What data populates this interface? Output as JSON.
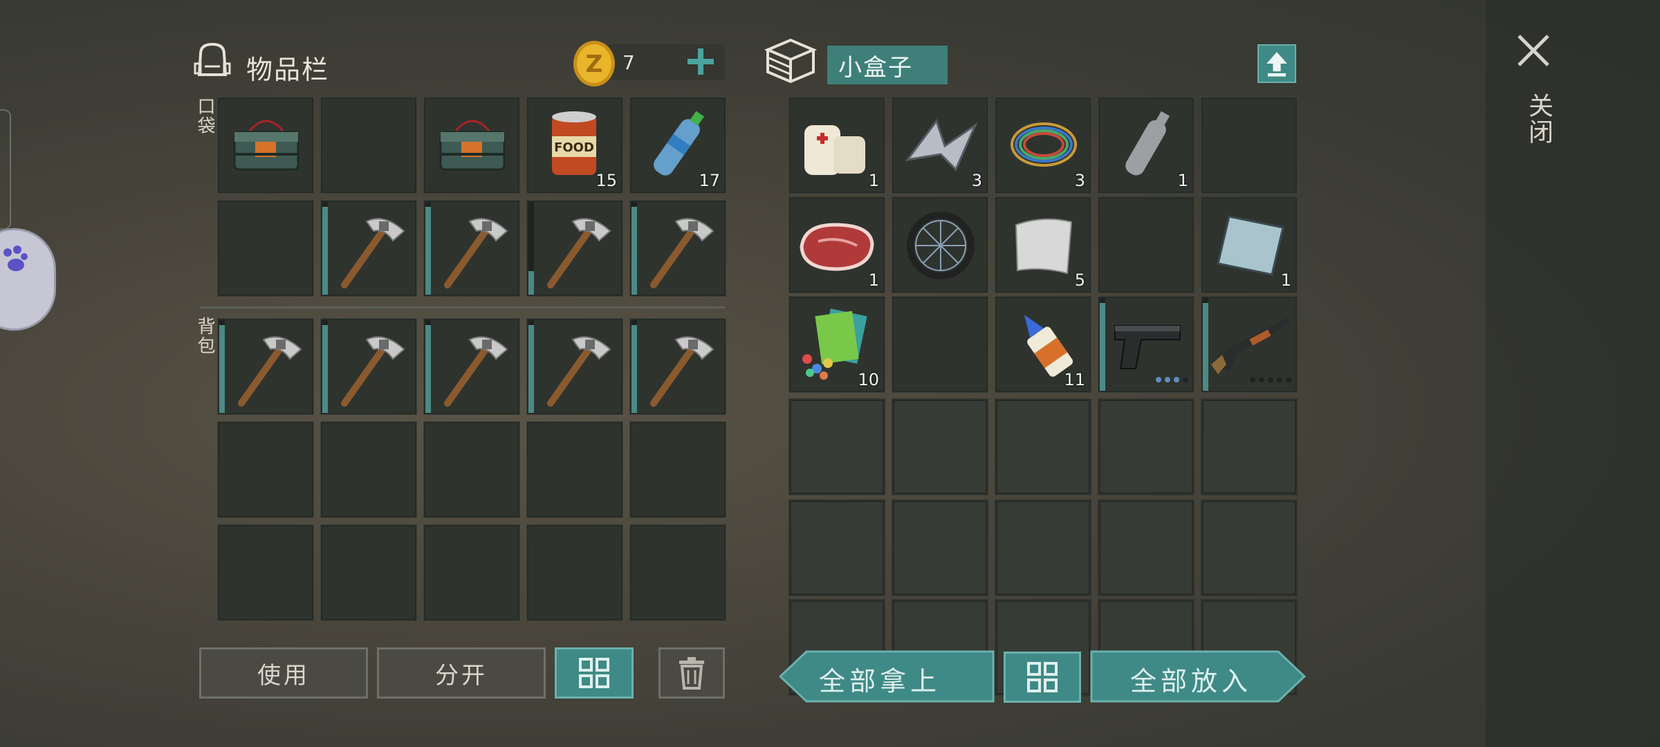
{
  "inventory": {
    "title": "物品栏",
    "coins": "7",
    "pocket_label": "口袋",
    "backpack_label": "背包",
    "pocket_slots": [
      {
        "item": "dynamite-bundle"
      },
      {
        "item": ""
      },
      {
        "item": "dynamite-bundle"
      },
      {
        "item": "canned-food",
        "count": "15"
      },
      {
        "item": "water-bottle",
        "count": "17"
      },
      {
        "item": ""
      },
      {
        "item": "pickaxe",
        "durability": 0.95
      },
      {
        "item": "pickaxe",
        "durability": 0.95
      },
      {
        "item": "pickaxe",
        "durability": 0.25
      },
      {
        "item": "pickaxe",
        "durability": 0.95
      }
    ],
    "backpack_slots": [
      {
        "item": "pickaxe",
        "durability": 0.95
      },
      {
        "item": "pickaxe",
        "durability": 0.95
      },
      {
        "item": "pickaxe",
        "durability": 0.95
      },
      {
        "item": "pickaxe",
        "durability": 0.95
      },
      {
        "item": "pickaxe",
        "durability": 0.95
      }
    ],
    "buttons": {
      "use": "使用",
      "split": "分开"
    }
  },
  "container": {
    "title": "小盒子",
    "slots": [
      {
        "item": "bandage",
        "count": "1"
      },
      {
        "item": "scrap-metal",
        "count": "3"
      },
      {
        "item": "wire-coil",
        "count": "3"
      },
      {
        "item": "empty-bottle",
        "count": "1"
      },
      {
        "item": ""
      },
      {
        "item": "raw-steak",
        "count": "1"
      },
      {
        "item": "wheel",
        "count": ""
      },
      {
        "item": "metal-plate",
        "count": "5"
      },
      {
        "item": ""
      },
      {
        "item": "glass-plate",
        "count": "1"
      },
      {
        "item": "seed-packets",
        "count": "10"
      },
      {
        "item": ""
      },
      {
        "item": "glue",
        "count": "11"
      },
      {
        "item": "pistol",
        "durability": 0.95,
        "ammo_loaded": 3,
        "ammo_capacity": 4
      },
      {
        "item": "shotgun",
        "durability": 0.95,
        "ammo_loaded": 0,
        "ammo_capacity": 5
      }
    ],
    "buttons": {
      "take_all": "全部拿上",
      "put_all": "全部放入"
    }
  },
  "close_label": "关闭",
  "colors": {
    "accent": "#3f8a86",
    "accent_border": "#6bb1ad",
    "slot": "#2f332e",
    "coin": "#d9a21c"
  }
}
